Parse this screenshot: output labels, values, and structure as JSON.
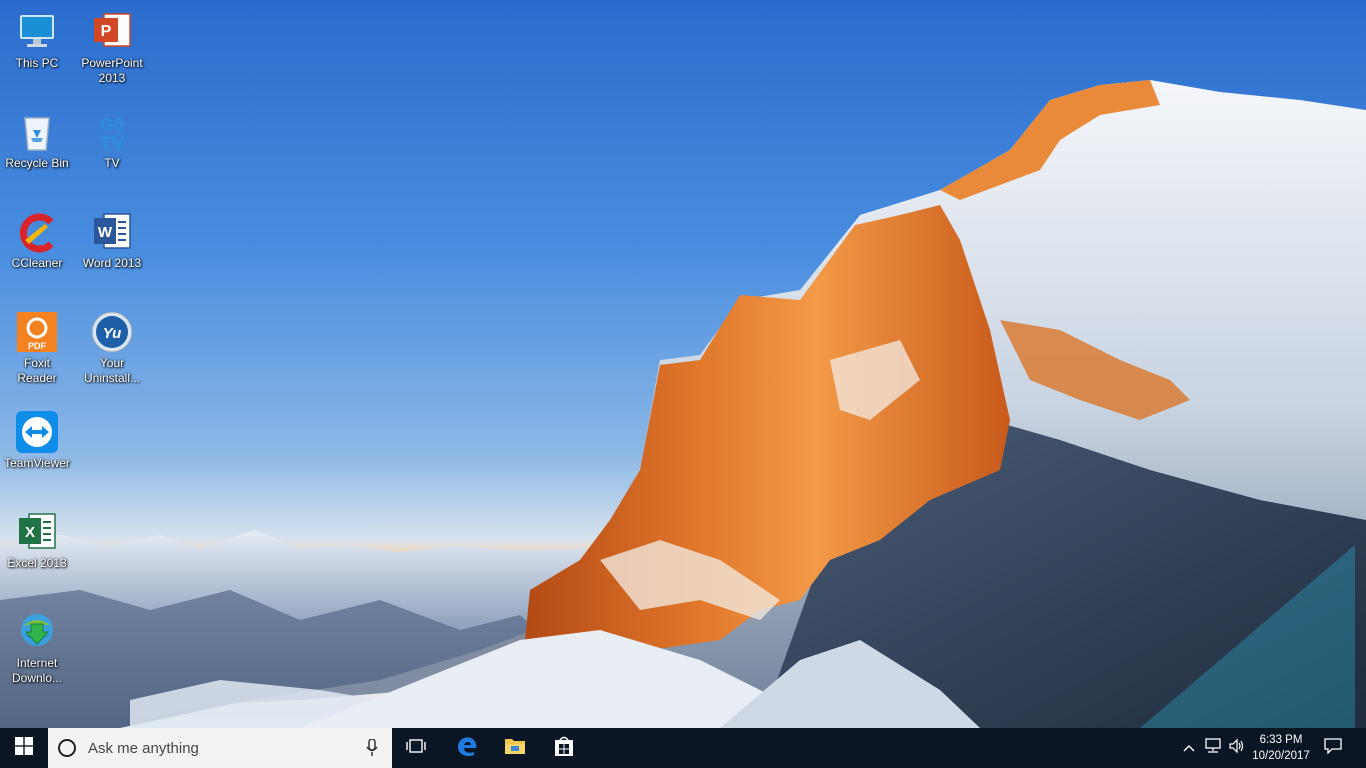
{
  "desktop_icons": [
    {
      "label": "This PC",
      "icon": "computer-icon"
    },
    {
      "label": "PowerPoint 2013",
      "icon": "powerpoint-icon"
    },
    {
      "label": "Recycle Bin",
      "icon": "recycle-bin-icon"
    },
    {
      "label": "TV",
      "icon": "gotv-icon",
      "glyph_text": "Gõ TV"
    },
    {
      "label": "CCleaner",
      "icon": "ccleaner-icon"
    },
    {
      "label": "Word 2013",
      "icon": "word-icon",
      "glyph_text": "W"
    },
    {
      "label": "Foxit Reader",
      "icon": "foxit-reader-icon",
      "glyph_text": "PDF"
    },
    {
      "label": "Your Uninstall...",
      "icon": "your-uninstaller-icon",
      "glyph_text": "Yu"
    },
    {
      "label": "TeamViewer",
      "icon": "teamviewer-icon"
    },
    {
      "label": "Excel 2013",
      "icon": "excel-icon",
      "glyph_text": "X"
    },
    {
      "label": "Internet Downlo...",
      "icon": "internet-download-manager-icon"
    }
  ],
  "taskbar": {
    "search_placeholder": "Ask me anything",
    "pinned": [
      "task-view-icon",
      "edge-icon",
      "file-explorer-icon",
      "store-icon"
    ],
    "tray": {
      "time": "6:33 PM",
      "date": "10/20/2017",
      "icons": [
        "chevron-up-icon",
        "network-icon",
        "volume-icon",
        "action-center-icon"
      ]
    }
  },
  "colors": {
    "taskbar_bg": "#0b1624",
    "search_bg": "#f3f3f3",
    "edge_blue": "#1f7be0",
    "explorer_yellow": "#f2c94c"
  }
}
